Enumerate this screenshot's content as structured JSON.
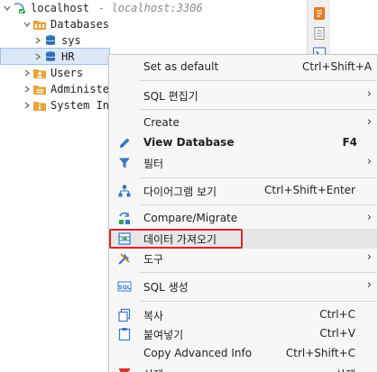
{
  "tree": {
    "connection": {
      "label": "localhost",
      "suffix": "- localhost:3306",
      "icon": "mysql-connection-icon"
    },
    "databases": {
      "label": "Databases",
      "icon": "folder-icon"
    },
    "schemas": [
      {
        "label": "sys",
        "icon": "database-icon"
      },
      {
        "label": "HR",
        "icon": "database-icon",
        "selected": true
      }
    ],
    "folders": [
      {
        "label": "Users",
        "icon": "users-folder-icon"
      },
      {
        "label": "Administer",
        "icon": "admin-folder-icon"
      },
      {
        "label": "System Info",
        "icon": "info-folder-icon"
      }
    ]
  },
  "menu": {
    "items": [
      {
        "label": "Set as default",
        "shortcut": "Ctrl+Shift+A"
      },
      {
        "label": "SQL 편집기",
        "submenu": true
      },
      {
        "label": "Create",
        "submenu": true
      },
      {
        "label": "View Database",
        "shortcut": "F4",
        "bold": true,
        "icon": "pencil-icon"
      },
      {
        "label": "필터",
        "submenu": true,
        "icon": "filter-icon"
      },
      {
        "label": "다이어그램 보기",
        "shortcut": "Ctrl+Shift+Enter",
        "icon": "diagram-icon"
      },
      {
        "label": "Compare/Migrate",
        "submenu": true,
        "icon": "compare-icon"
      },
      {
        "label": "데이터 가져오기",
        "icon": "import-data-icon",
        "highlighted": true
      },
      {
        "label": "도구",
        "submenu": true,
        "icon": "tools-icon"
      },
      {
        "label": "SQL 생성",
        "submenu": true,
        "icon": "sql-generate-icon"
      },
      {
        "label": "복사",
        "shortcut": "Ctrl+C",
        "icon": "copy-icon"
      },
      {
        "label": "붙여넣기",
        "shortcut": "Ctrl+V",
        "icon": "paste-icon"
      },
      {
        "label": "Copy Advanced Info",
        "shortcut": "Ctrl+Shift+C"
      },
      {
        "label": "삭제",
        "shortcut": "삭제",
        "icon": "delete-icon"
      }
    ]
  },
  "colors": {
    "highlight_border": "#e0242b",
    "selection": "#dbe8f8"
  }
}
